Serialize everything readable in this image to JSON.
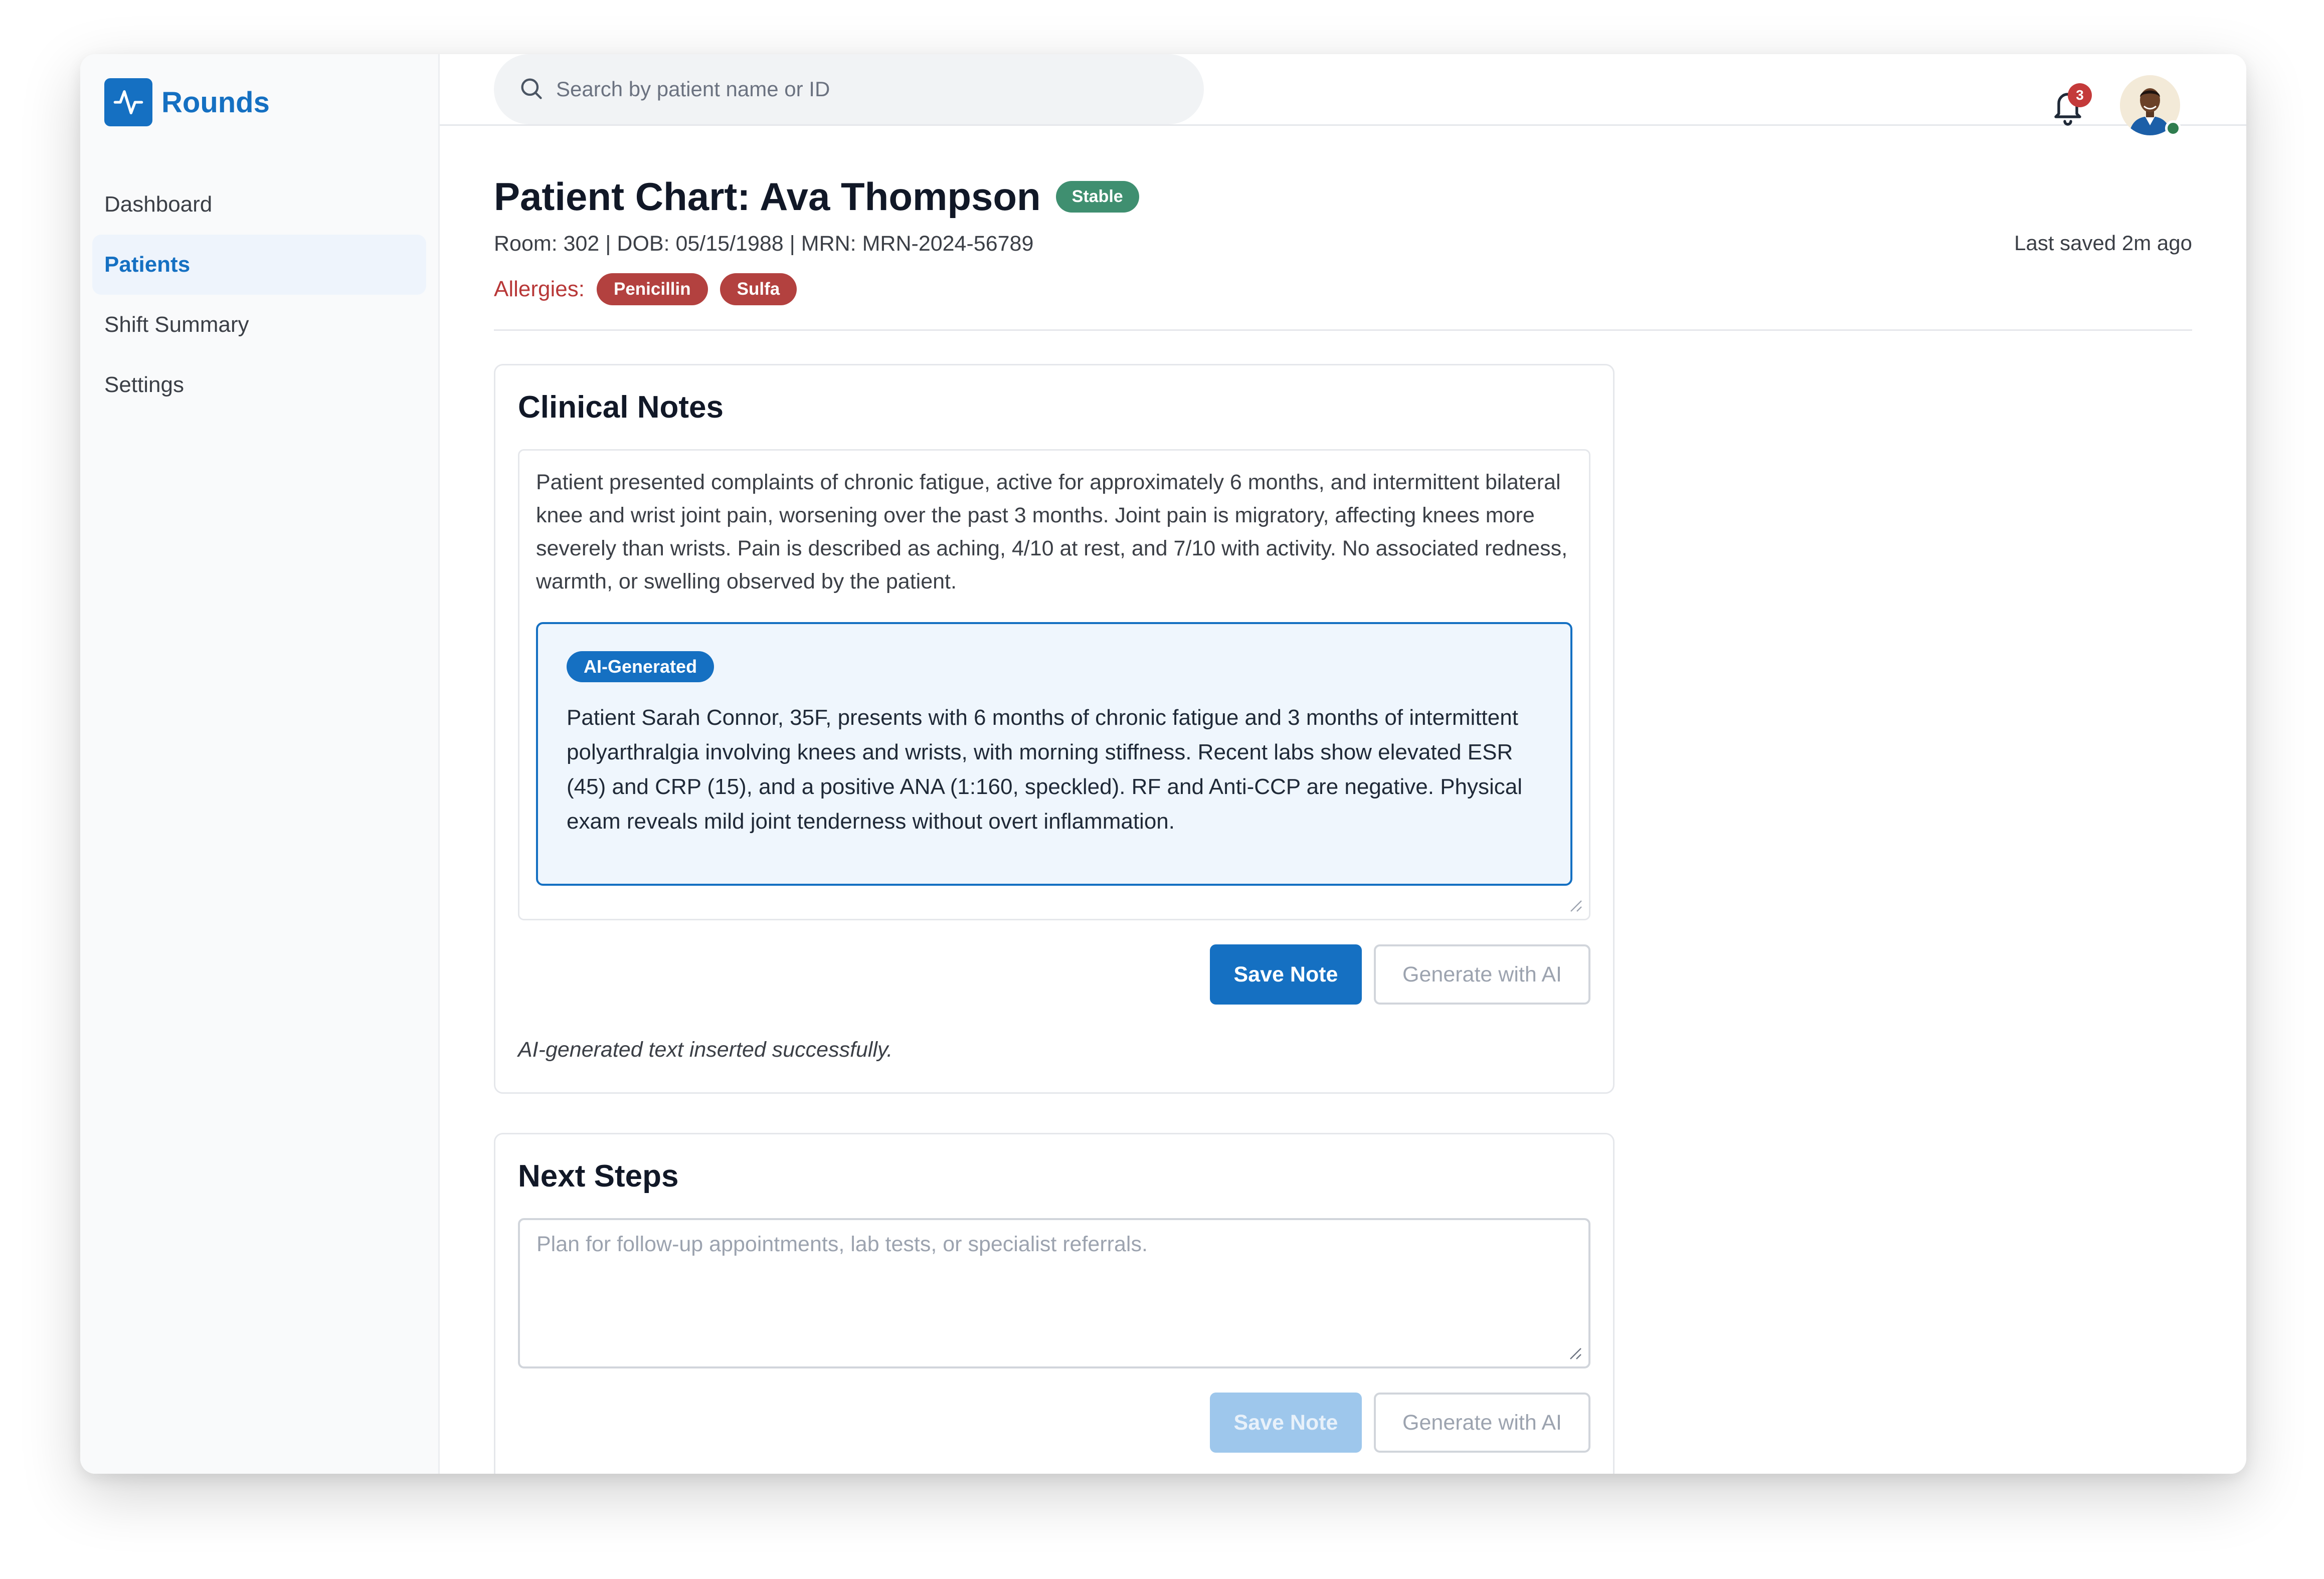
{
  "app": {
    "name": "Rounds",
    "brand_color": "#1570c2",
    "logo_icon": "pulse-icon"
  },
  "sidebar": {
    "items": [
      {
        "label": "Dashboard",
        "active": false
      },
      {
        "label": "Patients",
        "active": true
      },
      {
        "label": "Shift Summary",
        "active": false
      },
      {
        "label": "Settings",
        "active": false
      }
    ]
  },
  "topbar": {
    "search": {
      "placeholder": "Search by patient name or ID",
      "value": "",
      "icon": "search-icon"
    },
    "notifications": {
      "icon": "bell-icon",
      "count": "3"
    },
    "user": {
      "icon": "avatar",
      "status": "online",
      "status_color": "#2f7d4f"
    }
  },
  "patient": {
    "title": "Patient Chart: Ava Thompson",
    "status": "Stable",
    "status_color": "#3f8f70",
    "meta": "Room: 302 | DOB: 05/15/1988 | MRN: MRN-2024-56789",
    "last_saved": "Last saved 2m ago",
    "allergies_label": "Allergies:",
    "allergies": [
      "Penicillin",
      "Sulfa"
    ],
    "allergy_color": "#b3413f"
  },
  "clinical_notes": {
    "title": "Clinical Notes",
    "text": "Patient presented complaints of chronic fatigue, active for approximately 6 months, and intermittent bilateral knee and wrist joint pain, worsening over the past 3 months. Joint pain is migratory, affecting knees more severely than wrists. Pain is described as aching, 4/10 at rest, and 7/10 with activity. No associated redness, warmth, or swelling observed by the patient.",
    "ai_tag": "AI-Generated",
    "ai_text": "Patient Sarah Connor, 35F, presents with 6 months of chronic fatigue and 3 months of intermittent polyarthralgia involving knees and wrists, with morning stiffness. Recent labs show elevated ESR (45) and CRP (15), and a positive ANA (1:160, speckled). RF and Anti-CCP are negative. Physical exam reveals mild joint tenderness without overt inflammation.",
    "save_label": "Save Note",
    "generate_label": "Generate with AI",
    "status_message": "AI-generated text inserted successfully."
  },
  "next_steps": {
    "title": "Next Steps",
    "placeholder": "Plan for follow-up appointments, lab tests, or specialist referrals.",
    "value": "",
    "save_label": "Save Note",
    "generate_label": "Generate with AI"
  }
}
